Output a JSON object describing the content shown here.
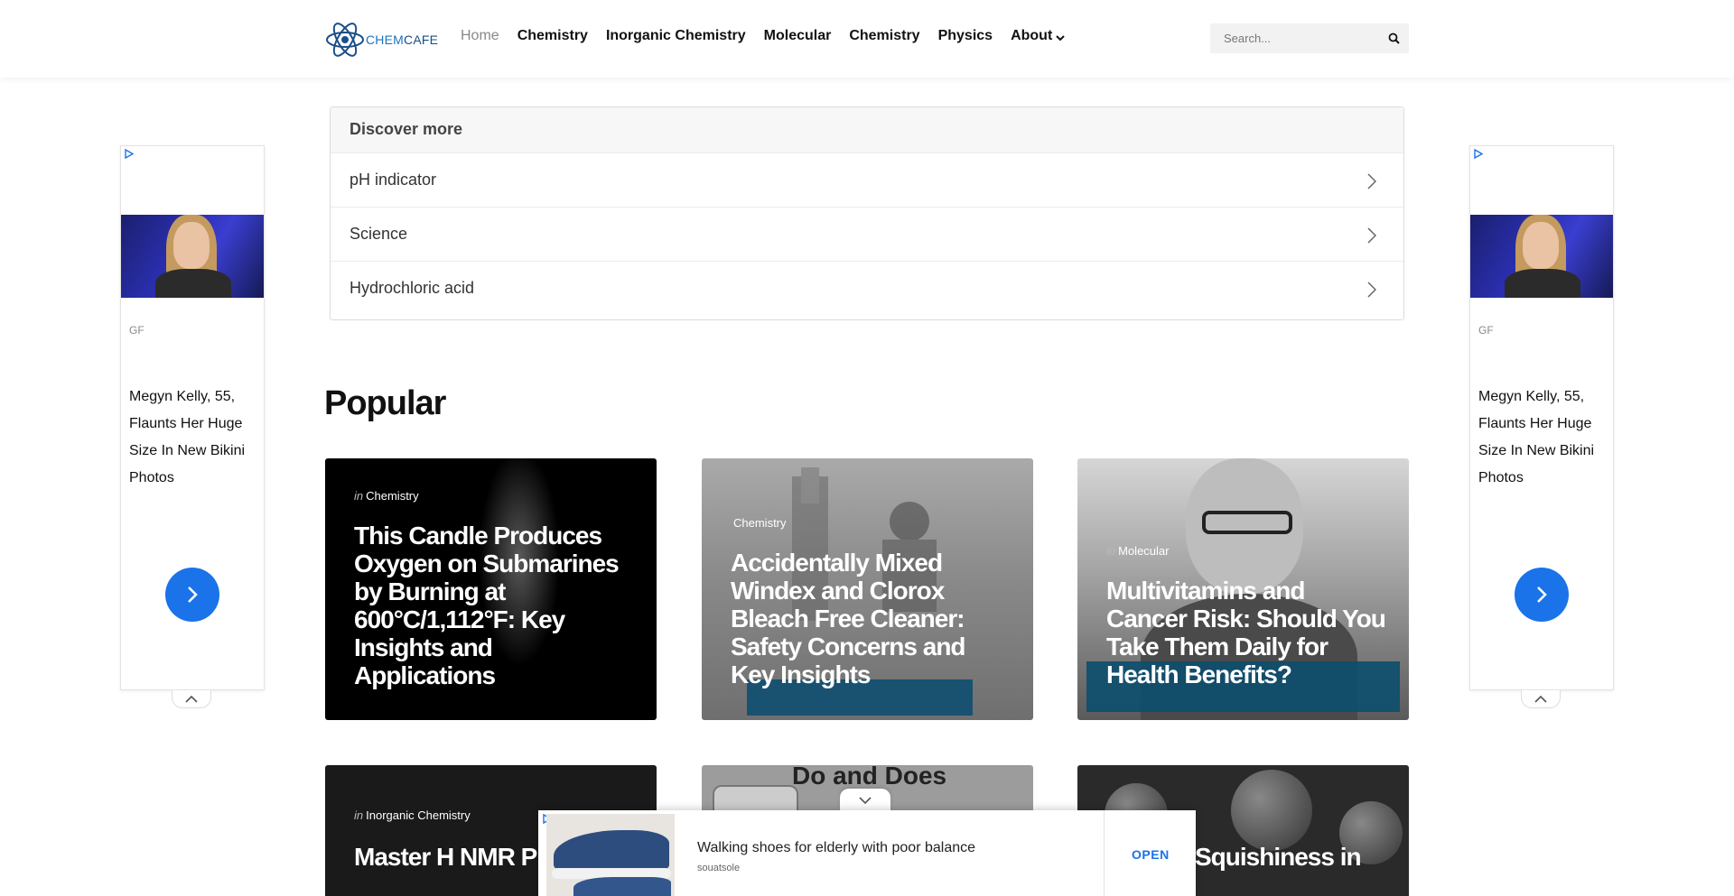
{
  "header": {
    "logo_prefix": "CHEM",
    "logo_suffix": "CAFE",
    "nav": [
      {
        "label": "Home"
      },
      {
        "label": "Chemistry"
      },
      {
        "label": "Inorganic Chemistry"
      },
      {
        "label": "Molecular"
      },
      {
        "label": "Chemistry"
      },
      {
        "label": "Physics"
      },
      {
        "label": "About"
      }
    ],
    "search_placeholder": "Search..."
  },
  "discover": {
    "title": "Discover more",
    "items": [
      {
        "label": "pH indicator"
      },
      {
        "label": "Science"
      },
      {
        "label": "Hydrochloric acid"
      }
    ]
  },
  "side_ad": {
    "source": "GF",
    "text": "Megyn Kelly, 55, Flaunts Her Huge Size In New Bikini Photos"
  },
  "popular": {
    "title": "Popular",
    "cards": [
      {
        "prefix": "in",
        "category": "Chemistry",
        "title": "This Candle Produces Oxygen on Submarines by Burning at 600°C/1,112°F: Key Insights and Applications"
      },
      {
        "prefix": "",
        "category": "Chemistry",
        "title": "Accidentally Mixed Windex and Clorox Bleach Free Cleaner: Safety Concerns and Key Insights"
      },
      {
        "prefix": "in",
        "category": "Molecular",
        "title": "Multivitamins and Cancer Risk: Should You Take Them Daily for Health Benefits?"
      },
      {
        "prefix": "in",
        "category": "Inorganic Chemistry",
        "title": "Master H NMR P"
      },
      {
        "prefix": "",
        "category": "",
        "title": "Do and Does"
      },
      {
        "prefix": "",
        "category": "",
        "title": "Squishiness in"
      }
    ]
  },
  "bottom_ad": {
    "headline": "Walking shoes for elderly with poor balance",
    "brand": "souatsole",
    "cta": "OPEN"
  },
  "colors": {
    "brand": "#1e73be",
    "accent_blue": "#1a73e8"
  }
}
